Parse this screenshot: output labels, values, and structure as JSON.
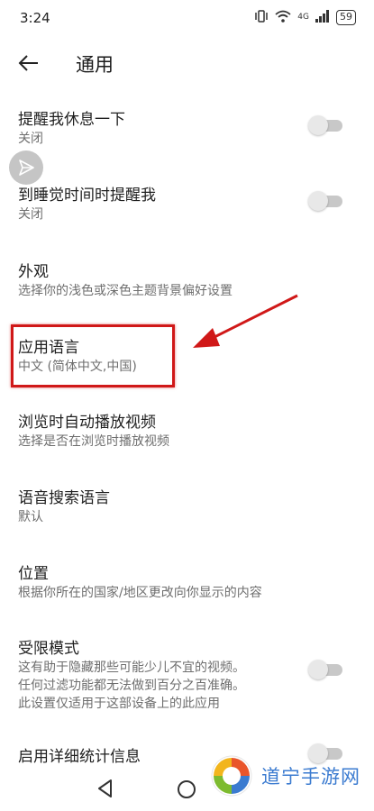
{
  "status_bar": {
    "time": "3:24",
    "network": "4G",
    "battery": "59"
  },
  "header": {
    "title": "通用",
    "back_icon": "arrow-left-icon"
  },
  "settings": [
    {
      "title": "提醒我休息一下",
      "subtitle": "关闭",
      "has_toggle": true,
      "toggle_on": false
    },
    {
      "title": "到睡觉时间时提醒我",
      "subtitle": "关闭",
      "has_toggle": true,
      "toggle_on": false
    },
    {
      "title": "外观",
      "subtitle": "选择你的浅色或深色主题背景偏好设置",
      "has_toggle": false
    },
    {
      "title": "应用语言",
      "subtitle": "中文 (简体中文,中国)",
      "has_toggle": false,
      "highlighted": true
    },
    {
      "title": "浏览时自动播放视频",
      "subtitle": "选择是否在浏览时播放视频",
      "has_toggle": false
    },
    {
      "title": "语音搜索语言",
      "subtitle": "默认",
      "has_toggle": false
    },
    {
      "title": "位置",
      "subtitle": "根据你所在的国家/地区更改向你显示的内容",
      "has_toggle": false
    },
    {
      "title": "受限模式",
      "subtitle_lines": [
        "这有助于隐藏那些可能少儿不宜的视频。",
        "任何过滤功能都无法做到百分之百准确。",
        "此设置仅适用于这部设备上的此应用"
      ],
      "has_toggle": true,
      "toggle_on": false
    },
    {
      "title": "启用详细统计信息",
      "has_toggle": true,
      "toggle_on": false
    }
  ],
  "annotation": {
    "highlight_color": "#d01818",
    "arrow_color": "#d01818"
  },
  "watermark": {
    "text": "道宁手游网",
    "color": "#3b7bd0"
  },
  "nav_bar": {
    "back_icon": "triangle-back-icon",
    "home_icon": "circle-home-icon"
  }
}
